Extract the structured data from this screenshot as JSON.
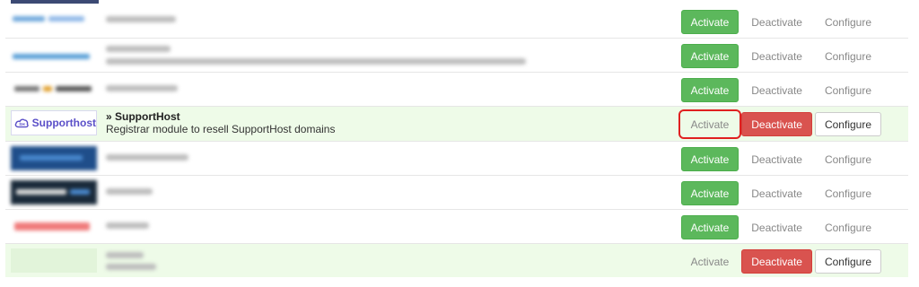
{
  "colors": {
    "success": "#5cb85c",
    "danger": "#d9534f",
    "highlight_border": "#e02020",
    "active_row_bg": "#eefbe8",
    "brand_purple": "#5a4fc8"
  },
  "rows": [
    {
      "state": "inactive",
      "activate_label": "Activate",
      "deactivate_label": "Deactivate",
      "configure_label": "Configure"
    },
    {
      "state": "inactive",
      "activate_label": "Activate",
      "deactivate_label": "Deactivate",
      "configure_label": "Configure"
    },
    {
      "state": "inactive",
      "activate_label": "Activate",
      "deactivate_label": "Deactivate",
      "configure_label": "Configure"
    },
    {
      "state": "active",
      "logo_text": "Supporthost",
      "name": "» SupportHost",
      "description": "Registrar module to resell SupportHost domains",
      "activate_label": "Activate",
      "deactivate_label": "Deactivate",
      "configure_label": "Configure"
    },
    {
      "state": "inactive",
      "activate_label": "Activate",
      "deactivate_label": "Deactivate",
      "configure_label": "Configure"
    },
    {
      "state": "inactive",
      "activate_label": "Activate",
      "deactivate_label": "Deactivate",
      "configure_label": "Configure"
    },
    {
      "state": "inactive",
      "activate_label": "Activate",
      "deactivate_label": "Deactivate",
      "configure_label": "Configure"
    },
    {
      "state": "active",
      "activate_label": "Activate",
      "deactivate_label": "Deactivate",
      "configure_label": "Configure"
    }
  ],
  "icons": {
    "supporthost_logo": "cloud-sh-icon"
  }
}
